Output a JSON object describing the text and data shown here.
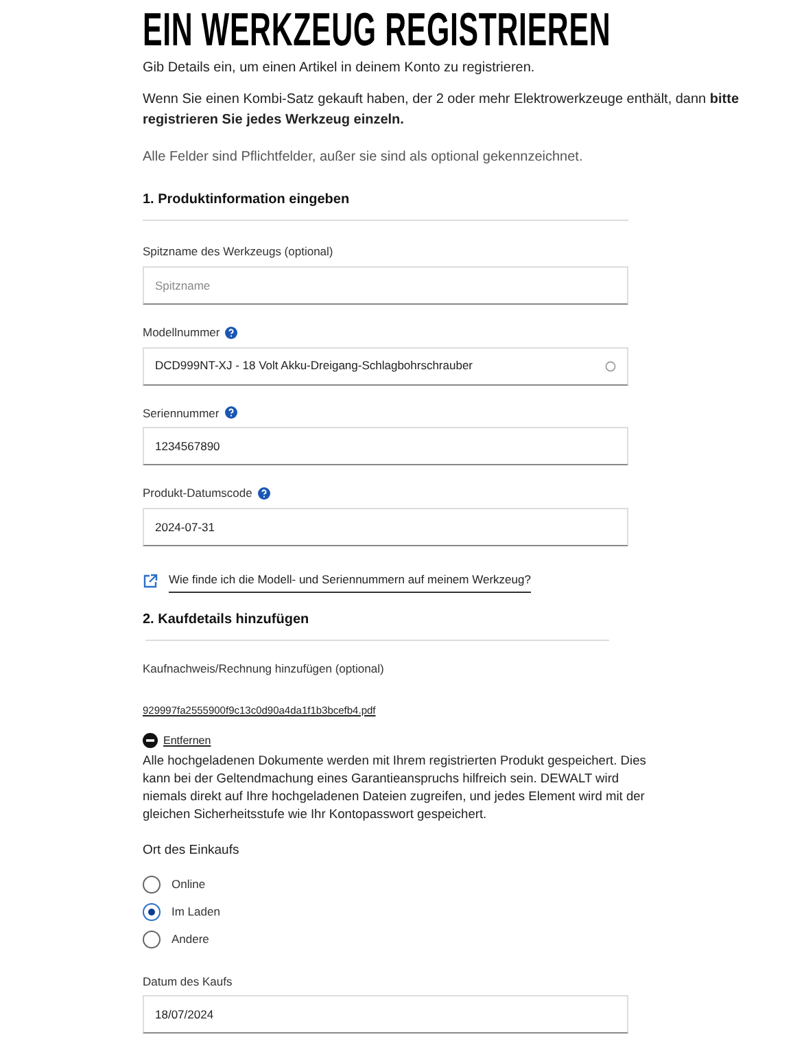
{
  "title": "EIN WERKZEUG REGISTRIEREN",
  "intro": "Gib Details ein, um einen Artikel in deinem Konto zu registrieren.",
  "notice": "Wenn Sie einen Kombi-Satz gekauft haben, der 2 oder mehr Elektrowerkzeuge enthält, dann **bitte registrieren Sie jedes Werkzeug einzeln.**",
  "required_note": "Alle Felder sind Pflichtfelder, außer sie sind als optional gekennzeichnet.",
  "sections": [
    {
      "heading": "1. Produktinformation eingeben",
      "items": [
        {
          "kind": "text",
          "label": "Spitzname des Werkzeugs (optional)",
          "help": false,
          "placeholder": "Spitzname"
        },
        {
          "kind": "select",
          "label": "Modellnummer",
          "help": true,
          "value": "DCD999NT-XJ - 18 Volt Akku-Dreigang-Schlagbohrschrauber"
        },
        {
          "kind": "text",
          "label": "Seriennummer",
          "help": true,
          "value": "1234567890"
        },
        {
          "kind": "text",
          "label": "Produkt-Datumscode",
          "help": true,
          "value": "2024-07-31"
        },
        {
          "kind": "link",
          "label": "Wie finde ich die Modell- und Seriennummern auf meinem Werkzeug?"
        }
      ]
    },
    {
      "heading": "2. Kaufdetails hinzufügen",
      "items": [
        {
          "kind": "file",
          "label": "Kaufnachweis/Rechnung hinzufügen (optional)",
          "filename": "929997fa2555900f9c13c0d90a4da1f1b3bcefb4.pdf",
          "remove": "Entfernen",
          "note": "Alle hochgeladenen Dokumente werden mit Ihrem registrierten Produkt gespeichert. Dies kann bei der Geltendmachung eines Garantieanspruchs hilfreich sein. DEWALT wird niemals direkt auf Ihre hochgeladenen Dateien zugreifen, und jedes Element wird mit der gleichen Sicherheitsstufe wie Ihr Kontopasswort gespeichert."
        },
        {
          "kind": "radio",
          "label": "Ort des Einkaufs",
          "options": [
            {
              "label": "Online",
              "selected": false
            },
            {
              "label": "Im Laden",
              "selected": true
            },
            {
              "label": "Andere",
              "selected": false
            }
          ]
        },
        {
          "kind": "text",
          "label": "Datum des Kaufs",
          "help": false,
          "value": "18/07/2024"
        }
      ]
    }
  ]
}
